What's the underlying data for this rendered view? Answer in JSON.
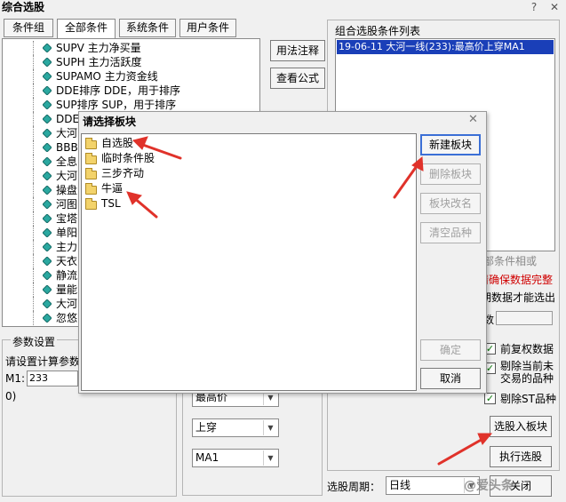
{
  "window": {
    "title": "综合选股",
    "help_glyph": "?",
    "close_glyph": "✕"
  },
  "tabs": [
    "条件组",
    "全部条件",
    "系统条件",
    "用户条件"
  ],
  "tree_items": [
    "SUPV 主力净买量",
    "SUPH 主力活跃度",
    "SUPAMO 主力资金线",
    "DDE排序 DDE，用于排序",
    "SUP排序 SUP，用于排序",
    "DDE大",
    "大河",
    "BBB",
    "全息",
    "大河",
    "操盘",
    "河图",
    "宝塔",
    "单阳",
    "主力",
    "天衣",
    "静流",
    "量能",
    "大河",
    "忽悠"
  ],
  "mid_buttons": {
    "usage": "用法注释",
    "view_formula": "查看公式"
  },
  "right_panel": {
    "list_title": "组合选股条件列表",
    "list_items": [
      "19-06-11 大河一线(233):最高价上穿MA1"
    ],
    "partial_texts": [
      "部条件相或",
      "请确保数据完整",
      "期数据才能选出",
      "数"
    ],
    "options": [
      "前复权数据",
      "剔除当前未\n交易的品种",
      "剔除ST品种"
    ],
    "select_to_block": "选股入板块",
    "execute": "执行选股",
    "period_label": "选股周期：",
    "period_value": "日线",
    "close": "关闭"
  },
  "params": {
    "group_title": "参数设置",
    "prompt": "请设置计算参数",
    "m1_label": "M1:",
    "m1_value": "233",
    "paren_text": "0)"
  },
  "combos": [
    "最高价",
    "上穿",
    "MA1"
  ],
  "dialog": {
    "title": "请选择板块",
    "close_glyph": "✕",
    "folders": [
      "自选股",
      "临时条件股",
      "三步齐动",
      "牛逼",
      "TSL"
    ],
    "buttons": {
      "new_block": "新建板块",
      "delete_block": "删除板块",
      "rename_block": "板块改名",
      "clear_items": "清空品种",
      "ok": "确定",
      "cancel": "取消"
    }
  },
  "watermark": "@爱头条",
  "colors": {
    "accent_blue": "#3b6fd6",
    "selected_row": "#1a3fb8",
    "warn_red": "#d00000",
    "arrow_red": "#e0322a"
  }
}
